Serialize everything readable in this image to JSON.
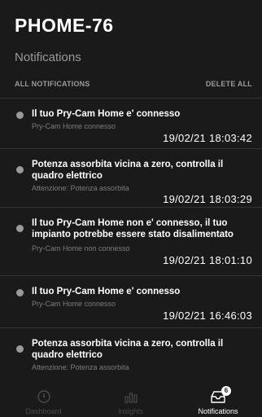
{
  "header": {
    "title": "PHOME-76",
    "subtitle": "Notifications"
  },
  "actions": {
    "all_label": "ALL NOTIFICATIONS",
    "delete_label": "DELETE ALL"
  },
  "notifications": [
    {
      "message": "Il tuo Pry-Cam Home e' connesso",
      "detail": "Pry-Cam Home connesso",
      "timestamp": "19/02/21 18:03:42"
    },
    {
      "message": "Potenza assorbita vicina a zero, controlla il quadro elettrico",
      "detail": "Attenzione: Potenza assorbita",
      "timestamp": "19/02/21 18:03:29"
    },
    {
      "message": "Il tuo Pry-Cam Home non e' connesso, il tuo impianto potrebbe essere stato disalimentato",
      "detail": "Pry-Cam Home non connesso",
      "timestamp": "19/02/21 18:01:10"
    },
    {
      "message": "Il tuo Pry-Cam Home e' connesso",
      "detail": "Pry-Cam Home connesso",
      "timestamp": "19/02/21 16:46:03"
    },
    {
      "message": "Potenza assorbita vicina a zero, controlla il quadro elettrico",
      "detail": "Attenzione: Potenza assorbita",
      "timestamp": ""
    }
  ],
  "tabbar": {
    "dashboard_label": "Dashboard",
    "insights_label": "Insights",
    "notifications_label": "Notifications",
    "notifications_badge": "6"
  },
  "colors": {
    "background": "#1a1a1a",
    "text_primary": "#ffffff",
    "text_secondary": "#9a9a9a",
    "divider": "#333333"
  }
}
